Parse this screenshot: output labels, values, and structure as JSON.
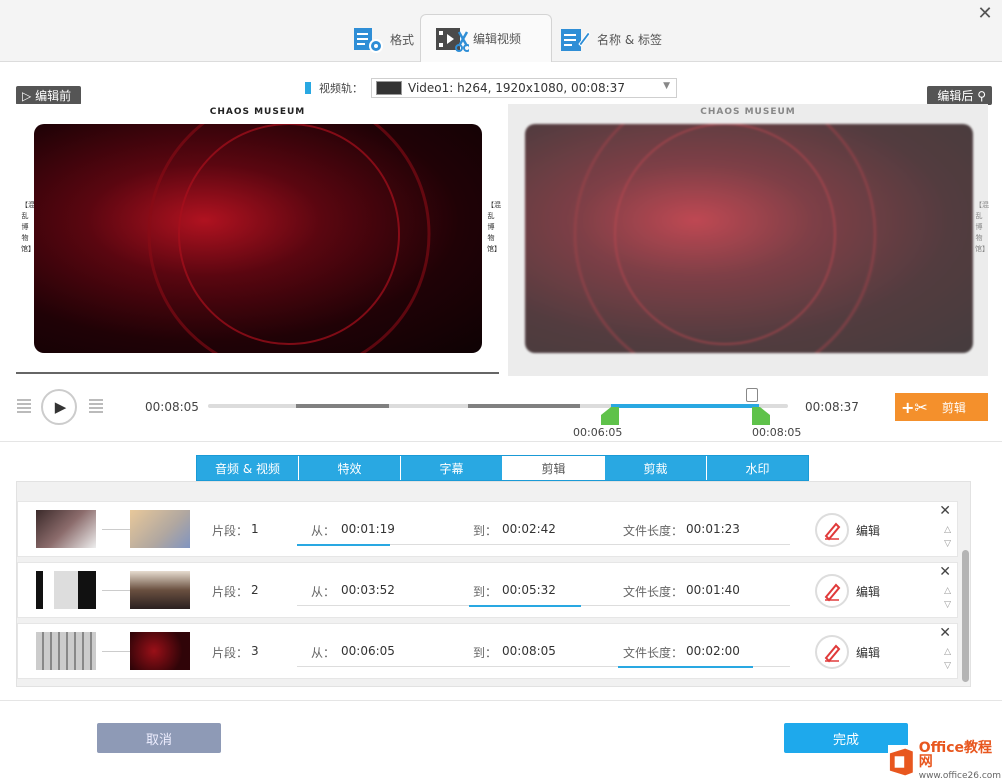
{
  "tabs": [
    {
      "label": "格式",
      "icon": "format-settings-icon"
    },
    {
      "label": "编辑视频",
      "icon": "video-edit-icon"
    },
    {
      "label": "名称 & 标签",
      "icon": "tag-edit-icon"
    }
  ],
  "preview": {
    "before_label": "编辑前",
    "after_label": "编辑后",
    "track_label": "视频轨：",
    "track_value": "Video1: h264, 1920x1080, 00:08:37",
    "video_brand": "CHAOS MUSEUM",
    "video_side_text": "【混乱博物馆】"
  },
  "timeline": {
    "current_time": "00:08:05",
    "total_time": "00:08:37",
    "marker_start": "00:06:05",
    "marker_end": "00:08:05",
    "cut_button": "剪辑"
  },
  "edit_tabs": [
    "音频 & 视频",
    "特效",
    "字幕",
    "剪辑",
    "剪裁",
    "水印"
  ],
  "selected_tab": "剪辑",
  "segments": [
    {
      "seg_label": "片段：",
      "num": "1",
      "from_label": "从：",
      "from": "00:01:19",
      "to_label": "到：",
      "to": "00:02:42",
      "len_label": "文件长度：",
      "len": "00:01:23",
      "edit": "编辑"
    },
    {
      "seg_label": "片段：",
      "num": "2",
      "from_label": "从：",
      "from": "00:03:52",
      "to_label": "到：",
      "to": "00:05:32",
      "len_label": "文件长度：",
      "len": "00:01:40",
      "edit": "编辑"
    },
    {
      "seg_label": "片段：",
      "num": "3",
      "from_label": "从：",
      "from": "00:06:05",
      "to_label": "到：",
      "to": "00:08:05",
      "len_label": "文件长度：",
      "len": "00:02:00",
      "edit": "编辑"
    }
  ],
  "buttons": {
    "cancel": "取消",
    "done": "完成"
  },
  "watermark": {
    "brand": "Office教程网",
    "url": "www.office26.com"
  },
  "colors": {
    "accent": "#29a8e2",
    "cut_button": "#f4902c",
    "marker": "#5fc24a"
  }
}
